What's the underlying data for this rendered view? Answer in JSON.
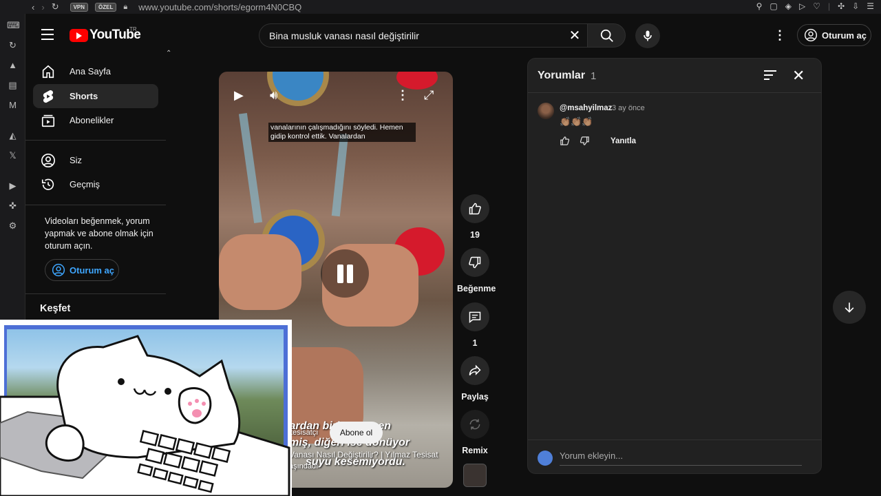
{
  "browser": {
    "url": "www.youtube.com/shorts/egorm4N0CBQ",
    "badges": [
      "VPN",
      "ÖZEL"
    ]
  },
  "header": {
    "logo_text": "YouTube",
    "region": "TR",
    "search_query": "Bina musluk vanası nasıl değiştirilir",
    "signin_label": "Oturum aç"
  },
  "sidebar": {
    "items": [
      {
        "label": "Ana Sayfa",
        "icon": "home-icon"
      },
      {
        "label": "Shorts",
        "icon": "shorts-icon"
      },
      {
        "label": "Abonelikler",
        "icon": "subscriptions-icon"
      },
      {
        "label": "Siz",
        "icon": "account-icon"
      },
      {
        "label": "Geçmiş",
        "icon": "history-icon"
      }
    ],
    "note": "Videoları beğenmek, yorum yapmak ve abone olmak için oturum açın.",
    "signin_label": "Oturum aç",
    "explore_heading": "Keşfet"
  },
  "video": {
    "caption": "vanalarının çalışmadığını söyledi. Hemen gidip kontrol ettik. Vanalardan",
    "bottom_overlay": "lardan biri tamamen",
    "bottom_line2": "miş, diğeri ise dönüyor",
    "bottom_line3": "suyu kesemiyordu.",
    "channel": "tesisatçı",
    "title_line": "Vanası Nasıl Değiştirilir? | Yılmaz Tesisat",
    "title_line2": "aşındadı",
    "subscribe_label": "Abone ol"
  },
  "actions": {
    "like_count": "19",
    "dislike_label": "Beğenme",
    "comment_count": "1",
    "share_label": "Paylaş",
    "remix_label": "Remix"
  },
  "comments": {
    "title": "Yorumlar",
    "count": "1",
    "items": [
      {
        "user": "@msahyilmaz",
        "time": "3 ay önce",
        "text": "👏🏽👏🏽👏🏽",
        "reply_label": "Yanıtla"
      }
    ],
    "add_placeholder": "Yorum ekleyin..."
  },
  "colors": {
    "background": "#0f0f0f",
    "brand_red": "#ff0000",
    "link_blue": "#3ea6ff",
    "panel": "#212121"
  }
}
